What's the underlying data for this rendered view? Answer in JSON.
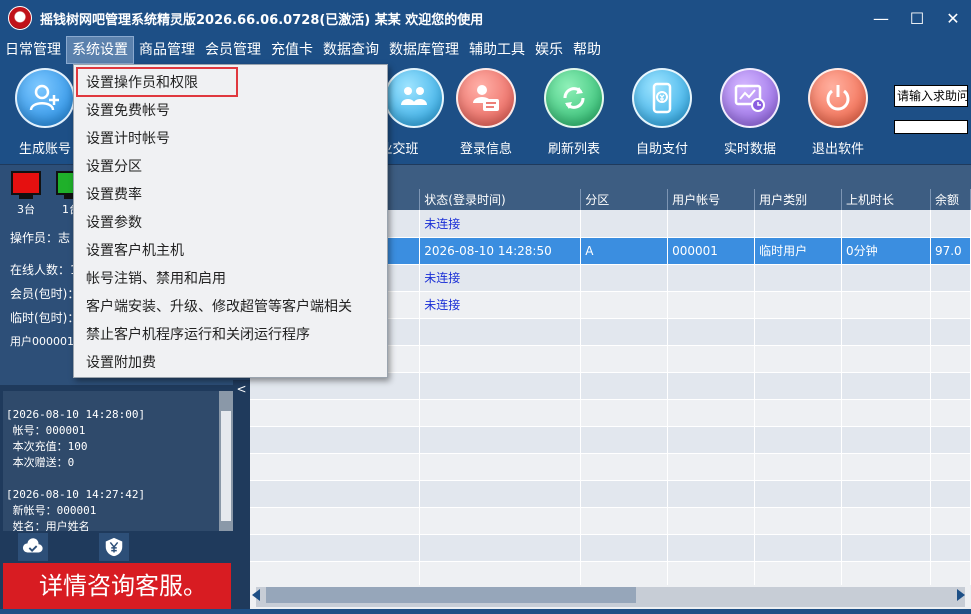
{
  "window": {
    "title": "摇钱树网吧管理系统精灵版2026.66.06.0728(已激活)  某某 欢迎您的使用",
    "minimize": "—",
    "maximize": "☐",
    "close": "✕"
  },
  "menu": [
    "日常管理",
    "系统设置",
    "商品管理",
    "会员管理",
    "充值卡",
    "数据查询",
    "数据库管理",
    "辅助工具",
    "娱乐",
    "帮助"
  ],
  "toolbar": {
    "create_account": "生成账号",
    "shift_handover": "业交班",
    "login_info": "登录信息",
    "refresh_list": "刷新列表",
    "self_pay": "自助支付",
    "realtime_data": "实时数据",
    "exit": "退出软件"
  },
  "search": {
    "placeholder": "请输入求助问"
  },
  "left": {
    "pc_red_count": "3台",
    "pc_green_count": "1台",
    "operator": "操作员：",
    "operator_value": "志",
    "online": "在线人数：1",
    "member": "会员(包时)：",
    "temp": "临时(包时)：",
    "user_line": "用户000001,"
  },
  "log": {
    "text": "[2026-08-10 14:28:00]\n 帐号：000001\n 本次充值：100\n 本次赠送：0\n\n[2026-08-10 14:27:42]\n 新帐号：000001\n 姓名：用户姓名"
  },
  "banner": "详情咨询客服。",
  "collapse": "<",
  "grid": {
    "columns": [
      "",
      "状态(登录时间)",
      "分区",
      "用户帐号",
      "用户类别",
      "上机时长",
      "余额"
    ],
    "rows": [
      [
        "",
        "未连接",
        "",
        "",
        "",
        "",
        ""
      ],
      [
        "",
        "2026-08-10 14:28:50",
        "A",
        "000001",
        "临时用户",
        "0分钟",
        "97.0"
      ],
      [
        "",
        "未连接",
        "",
        "",
        "",
        "",
        ""
      ],
      [
        "",
        "未连接",
        "",
        "",
        "",
        "",
        ""
      ],
      [
        "",
        "",
        "",
        "",
        "",
        "",
        ""
      ],
      [
        "",
        "",
        "",
        "",
        "",
        "",
        ""
      ],
      [
        "",
        "",
        "",
        "",
        "",
        "",
        ""
      ],
      [
        "",
        "",
        "",
        "",
        "",
        "",
        ""
      ],
      [
        "",
        "",
        "",
        "",
        "",
        "",
        ""
      ],
      [
        "",
        "",
        "",
        "",
        "",
        "",
        ""
      ],
      [
        "",
        "",
        "",
        "",
        "",
        "",
        ""
      ],
      [
        "",
        "",
        "",
        "",
        "",
        "",
        ""
      ],
      [
        "",
        "",
        "",
        "",
        "",
        "",
        ""
      ],
      [
        "",
        "",
        "",
        "",
        "",
        "",
        ""
      ]
    ]
  },
  "dropdown": [
    "设置操作员和权限",
    "设置免费帐号",
    "设置计时帐号",
    "设置分区",
    "设置费率",
    "设置参数",
    "设置客户机主机",
    "帐号注销、禁用和启用",
    "客户端安装、升级、修改超管等客户端相关",
    "禁止客户机程序运行和关闭运行程序",
    "设置附加费"
  ],
  "colors": {
    "accent": "#1d4f86",
    "selection": "#3b8ee0",
    "banner": "#d81c22",
    "highlight": "#e0383e"
  }
}
